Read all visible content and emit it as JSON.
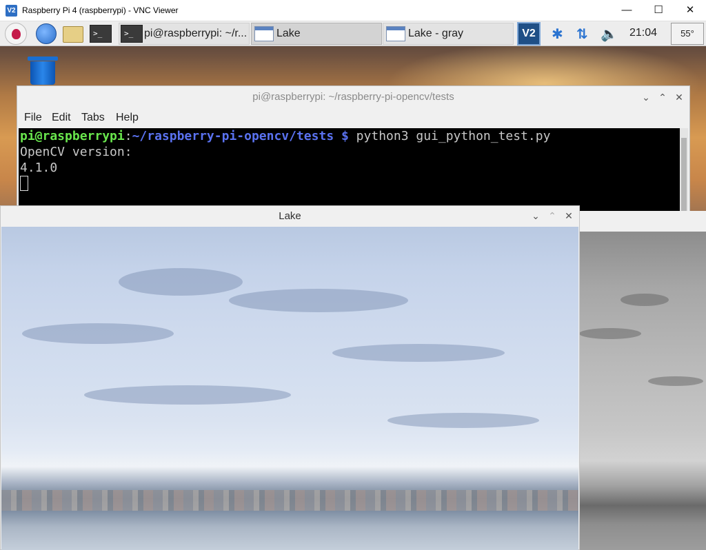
{
  "vnc_window": {
    "title": "Raspberry Pi 4 (raspberrypi) - VNC Viewer",
    "app_icon": "V2",
    "minimize_glyph": "—",
    "maximize_glyph": "☐",
    "close_glyph": "✕"
  },
  "taskbar": {
    "launchers": [
      {
        "name": "raspberry-menu-icon"
      },
      {
        "name": "web-browser-icon"
      },
      {
        "name": "file-manager-icon"
      },
      {
        "name": "terminal-launcher-icon",
        "glyph": ">_"
      }
    ],
    "tasks": [
      {
        "label": "pi@raspberrypi: ~/r...",
        "glyph": ">_"
      },
      {
        "label": "Lake"
      },
      {
        "label": "Lake - gray"
      }
    ],
    "tray": {
      "vnc_icon_text": "V2",
      "bluetooth_glyph": "✱",
      "network_glyph": "⇅",
      "volume_glyph": "🔈",
      "clock": "21:04",
      "cpu_temp": "55°"
    }
  },
  "terminal_window": {
    "title": "pi@raspberrypi: ~/raspberry-pi-opencv/tests",
    "controls": {
      "minimize": "⌄",
      "maximize": "⌃",
      "close": "✕"
    },
    "menu": [
      "File",
      "Edit",
      "Tabs",
      "Help"
    ],
    "lines": {
      "prompt_user": "pi@raspberrypi",
      "prompt_colon": ":",
      "prompt_path": "~/raspberry-pi-opencv/tests $",
      "command": " python3 gui_python_test.py",
      "output_1": "OpenCV version:",
      "output_2": "4.1.0"
    }
  },
  "lake_window": {
    "title": "Lake",
    "controls": {
      "minimize": "⌄",
      "maximize": "⌃",
      "close": "✕"
    }
  },
  "lake_gray_window": {
    "title": "Lake - gray"
  }
}
